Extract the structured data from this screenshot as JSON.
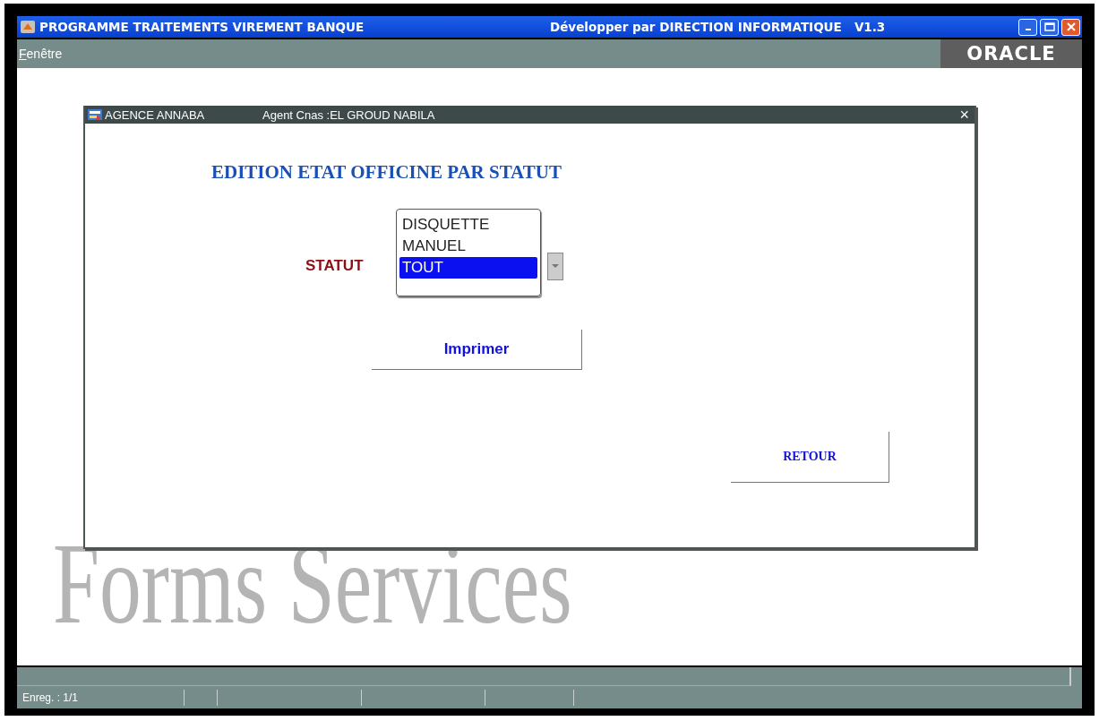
{
  "window": {
    "title": "PROGRAMME TRAITEMENTS VIREMENT BANQUE",
    "subtitle": "Développer par DIRECTION INFORMATIQUE   V1.3"
  },
  "menu": [
    {
      "label": "Fenêtre"
    }
  ],
  "logo": "ORACLE",
  "background_text": "Forms Services",
  "dialog": {
    "title": "AGENCE ANNABA",
    "agent": "Agent Cnas :EL GROUD NABILA",
    "close": "×",
    "heading": "EDITION ETAT OFFICINE PAR STATUT",
    "field_label": "STATUT",
    "options": [
      {
        "label": "DISQUETTE",
        "selected": false
      },
      {
        "label": "MANUEL",
        "selected": false
      },
      {
        "label": "TOUT",
        "selected": true
      }
    ],
    "buttons": [
      {
        "label": "Imprimer",
        "kind": "sans"
      },
      {
        "label": "RETOUR",
        "kind": "serif"
      }
    ]
  },
  "status_bar": {
    "record": "Enreg. : 1/1"
  }
}
